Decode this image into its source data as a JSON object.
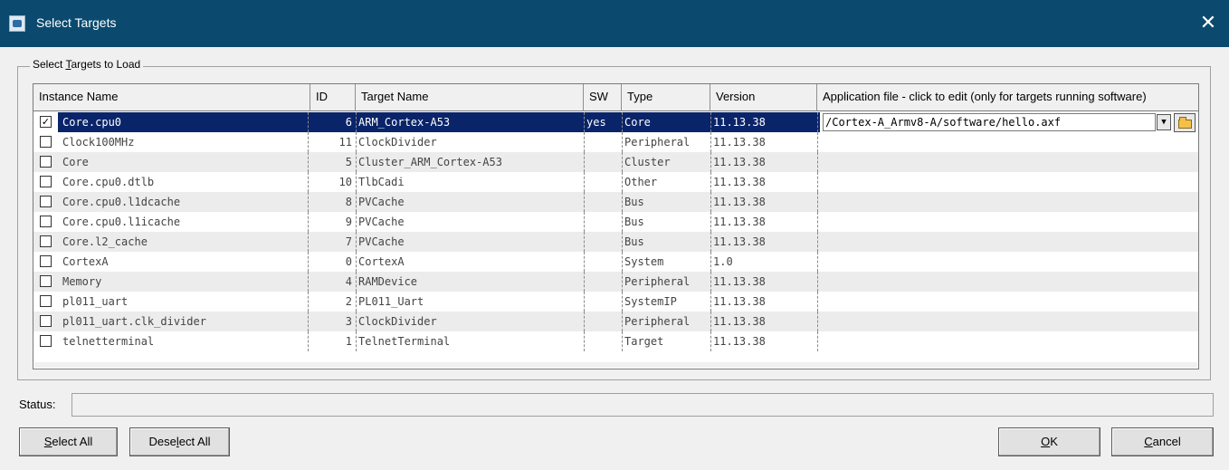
{
  "window": {
    "title": "Select Targets",
    "close_glyph": "✕"
  },
  "group": {
    "legend_pre": "Select ",
    "legend_accel": "T",
    "legend_post": "argets to Load"
  },
  "columns": [
    "Instance Name",
    "ID",
    "Target Name",
    "SW",
    "Type",
    "Version",
    "Application file - click to edit (only for targets running software)"
  ],
  "rows": [
    {
      "checked": true,
      "instance": "Core.cpu0",
      "id": "6",
      "target": "ARM_Cortex-A53",
      "sw": "yes",
      "type": "Core",
      "version": "11.13.38",
      "app_file": "/Cortex-A_Armv8-A/software/hello.axf"
    },
    {
      "checked": false,
      "instance": "Clock100MHz",
      "id": "11",
      "target": "ClockDivider",
      "sw": "",
      "type": "Peripheral",
      "version": "11.13.38",
      "app_file": ""
    },
    {
      "checked": false,
      "instance": "Core",
      "id": "5",
      "target": "Cluster_ARM_Cortex-A53",
      "sw": "",
      "type": "Cluster",
      "version": "11.13.38",
      "app_file": ""
    },
    {
      "checked": false,
      "instance": "Core.cpu0.dtlb",
      "id": "10",
      "target": "TlbCadi",
      "sw": "",
      "type": "Other",
      "version": "11.13.38",
      "app_file": ""
    },
    {
      "checked": false,
      "instance": "Core.cpu0.l1dcache",
      "id": "8",
      "target": "PVCache",
      "sw": "",
      "type": "Bus",
      "version": "11.13.38",
      "app_file": ""
    },
    {
      "checked": false,
      "instance": "Core.cpu0.l1icache",
      "id": "9",
      "target": "PVCache",
      "sw": "",
      "type": "Bus",
      "version": "11.13.38",
      "app_file": ""
    },
    {
      "checked": false,
      "instance": "Core.l2_cache",
      "id": "7",
      "target": "PVCache",
      "sw": "",
      "type": "Bus",
      "version": "11.13.38",
      "app_file": ""
    },
    {
      "checked": false,
      "instance": "CortexA",
      "id": "0",
      "target": "CortexA",
      "sw": "",
      "type": "System",
      "version": "1.0",
      "app_file": ""
    },
    {
      "checked": false,
      "instance": "Memory",
      "id": "4",
      "target": "RAMDevice",
      "sw": "",
      "type": "Peripheral",
      "version": "11.13.38",
      "app_file": ""
    },
    {
      "checked": false,
      "instance": "pl011_uart",
      "id": "2",
      "target": "PL011_Uart",
      "sw": "",
      "type": "SystemIP",
      "version": "11.13.38",
      "app_file": ""
    },
    {
      "checked": false,
      "instance": "pl011_uart.clk_divider",
      "id": "3",
      "target": "ClockDivider",
      "sw": "",
      "type": "Peripheral",
      "version": "11.13.38",
      "app_file": ""
    },
    {
      "checked": false,
      "instance": "telnetterminal",
      "id": "1",
      "target": "TelnetTerminal",
      "sw": "",
      "type": "Target",
      "version": "11.13.38",
      "app_file": ""
    }
  ],
  "status": {
    "label": "Status:",
    "value": ""
  },
  "buttons": {
    "select_all": {
      "accel": "S",
      "rest": "elect All"
    },
    "deselect_all": {
      "pre": "Dese",
      "accel": "l",
      "rest": "ect All"
    },
    "ok": {
      "accel": "O",
      "rest": "K"
    },
    "cancel": {
      "accel": "C",
      "rest": "ancel"
    }
  },
  "colors": {
    "title_bar": "#0b4a6e",
    "selection": "#0a246a",
    "alt_row": "#ececec"
  },
  "icons": {
    "app": "app-icon",
    "close": "close-icon",
    "checkbox": "checkbox-icon",
    "dropdown": "chevron-down-icon",
    "browse": "folder-open-icon"
  }
}
